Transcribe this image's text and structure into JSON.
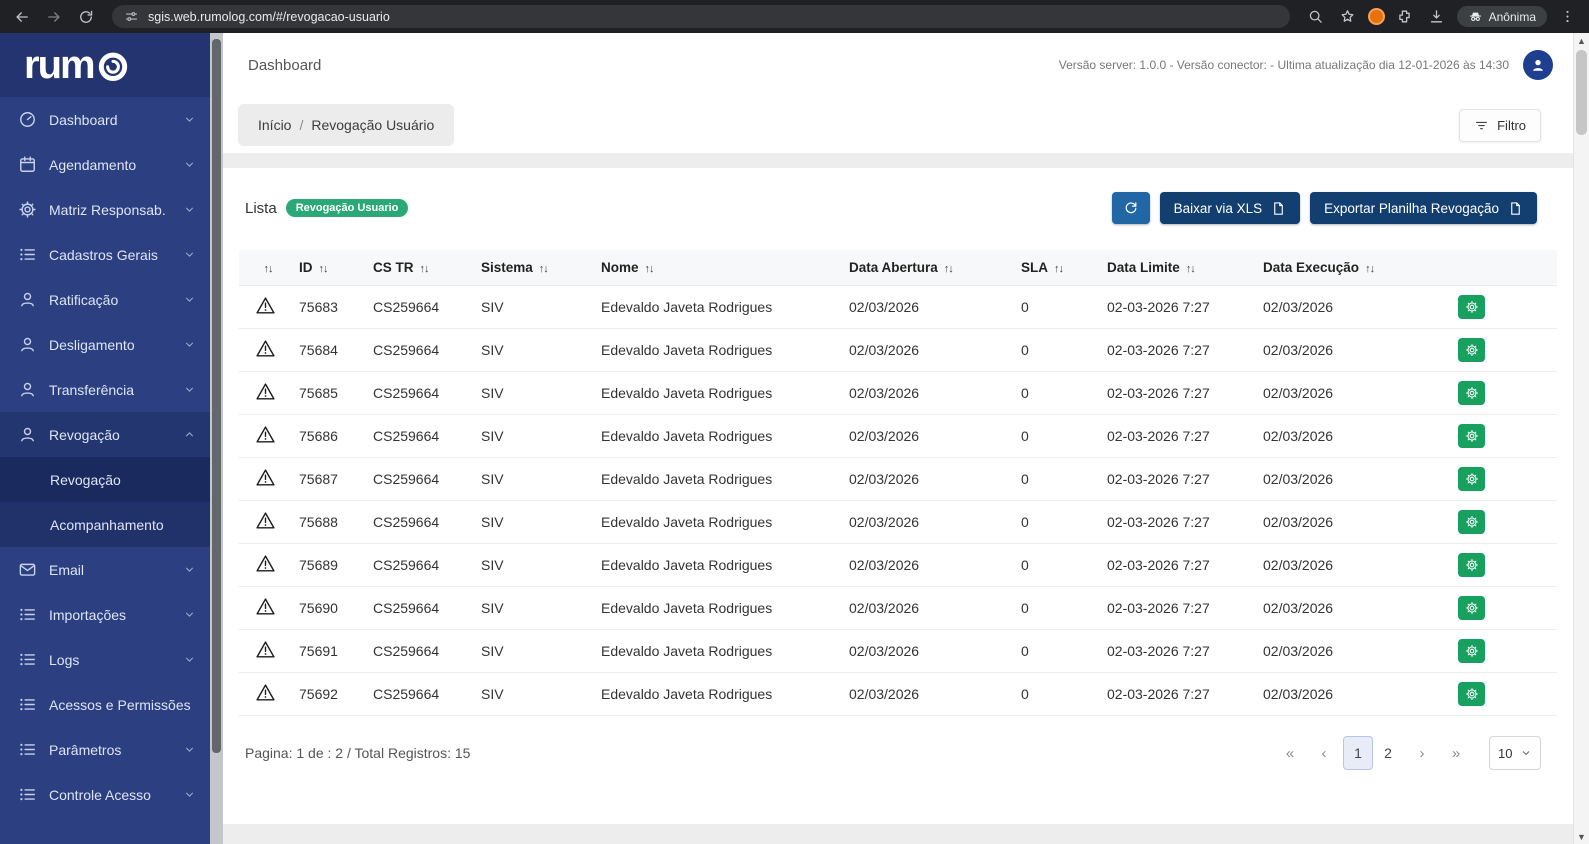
{
  "colors": {
    "sidebar_blue": "#2c3f80",
    "logo_band_blue": "#233470",
    "badge_green": "#2aa876",
    "gear_button_green": "#17a05e",
    "navy_button": "#123e70",
    "refresh_button_blue": "#2166a5",
    "avatar_blue": "#1e3f8f",
    "browser_bar": "#202124",
    "extension_orange": "#e8710a"
  },
  "browser": {
    "url": "sgis.web.rumolog.com/#/revogacao-usuario",
    "profile_label": "Anônima"
  },
  "sidebar": {
    "logo_prefix": "rum",
    "items": [
      {
        "label": "Dashboard",
        "icon": "gauge",
        "chevron": "down"
      },
      {
        "label": "Agendamento",
        "icon": "calendar",
        "chevron": "down"
      },
      {
        "label": "Matriz Responsab.",
        "icon": "gear",
        "chevron": "down"
      },
      {
        "label": "Cadastros Gerais",
        "icon": "list",
        "chevron": "down"
      },
      {
        "label": "Ratificação",
        "icon": "person",
        "chevron": "down"
      },
      {
        "label": "Desligamento",
        "icon": "person",
        "chevron": "down"
      },
      {
        "label": "Transferência",
        "icon": "person",
        "chevron": "down"
      },
      {
        "label": "Revogação",
        "icon": "person",
        "chevron": "up",
        "expanded": true,
        "children": [
          "Revogação",
          "Acompanhamento"
        ],
        "active_child": "Revogação"
      },
      {
        "label": "Email",
        "icon": "mail",
        "chevron": "down"
      },
      {
        "label": "Importações",
        "icon": "list",
        "chevron": "down"
      },
      {
        "label": "Logs",
        "icon": "list",
        "chevron": "down"
      },
      {
        "label": "Acessos e Permissões",
        "icon": "list",
        "chevron": null
      },
      {
        "label": "Parâmetros",
        "icon": "list",
        "chevron": "down"
      },
      {
        "label": "Controle Acesso",
        "icon": "list",
        "chevron": "down"
      }
    ]
  },
  "header": {
    "title": "Dashboard",
    "version_text": "Versão server: 1.0.0 -  Versão conector: -  Ultima atualização dia 12-01-2026 às 14:30"
  },
  "breadcrumb": {
    "home": "Início",
    "separator": "/",
    "current": "Revogação Usuário"
  },
  "toolbar": {
    "filter_label": "Filtro"
  },
  "list": {
    "title": "Lista",
    "badge": "Revogação Usuario",
    "download_xls_label": "Baixar via XLS",
    "export_label": "Exportar Planilha Revogação"
  },
  "table": {
    "columns": [
      "ID",
      "CS TR",
      "Sistema",
      "Nome",
      "Data Abertura",
      "SLA",
      "Data Limite",
      "Data Execução"
    ],
    "rows": [
      {
        "id": "75683",
        "cs_tr": "CS259664",
        "sistema": "SIV",
        "nome": "Edevaldo Javeta Rodrigues",
        "data_abertura": "02/03/2026",
        "sla": "0",
        "data_limite": "02-03-2026 7:27",
        "data_execucao": "02/03/2026"
      },
      {
        "id": "75684",
        "cs_tr": "CS259664",
        "sistema": "SIV",
        "nome": "Edevaldo Javeta Rodrigues",
        "data_abertura": "02/03/2026",
        "sla": "0",
        "data_limite": "02-03-2026 7:27",
        "data_execucao": "02/03/2026"
      },
      {
        "id": "75685",
        "cs_tr": "CS259664",
        "sistema": "SIV",
        "nome": "Edevaldo Javeta Rodrigues",
        "data_abertura": "02/03/2026",
        "sla": "0",
        "data_limite": "02-03-2026 7:27",
        "data_execucao": "02/03/2026"
      },
      {
        "id": "75686",
        "cs_tr": "CS259664",
        "sistema": "SIV",
        "nome": "Edevaldo Javeta Rodrigues",
        "data_abertura": "02/03/2026",
        "sla": "0",
        "data_limite": "02-03-2026 7:27",
        "data_execucao": "02/03/2026"
      },
      {
        "id": "75687",
        "cs_tr": "CS259664",
        "sistema": "SIV",
        "nome": "Edevaldo Javeta Rodrigues",
        "data_abertura": "02/03/2026",
        "sla": "0",
        "data_limite": "02-03-2026 7:27",
        "data_execucao": "02/03/2026"
      },
      {
        "id": "75688",
        "cs_tr": "CS259664",
        "sistema": "SIV",
        "nome": "Edevaldo Javeta Rodrigues",
        "data_abertura": "02/03/2026",
        "sla": "0",
        "data_limite": "02-03-2026 7:27",
        "data_execucao": "02/03/2026"
      },
      {
        "id": "75689",
        "cs_tr": "CS259664",
        "sistema": "SIV",
        "nome": "Edevaldo Javeta Rodrigues",
        "data_abertura": "02/03/2026",
        "sla": "0",
        "data_limite": "02-03-2026 7:27",
        "data_execucao": "02/03/2026"
      },
      {
        "id": "75690",
        "cs_tr": "CS259664",
        "sistema": "SIV",
        "nome": "Edevaldo Javeta Rodrigues",
        "data_abertura": "02/03/2026",
        "sla": "0",
        "data_limite": "02-03-2026 7:27",
        "data_execucao": "02/03/2026"
      },
      {
        "id": "75691",
        "cs_tr": "CS259664",
        "sistema": "SIV",
        "nome": "Edevaldo Javeta Rodrigues",
        "data_abertura": "02/03/2026",
        "sla": "0",
        "data_limite": "02-03-2026 7:27",
        "data_execucao": "02/03/2026"
      },
      {
        "id": "75692",
        "cs_tr": "CS259664",
        "sistema": "SIV",
        "nome": "Edevaldo Javeta Rodrigues",
        "data_abertura": "02/03/2026",
        "sla": "0",
        "data_limite": "02-03-2026 7:27",
        "data_execucao": "02/03/2026"
      }
    ]
  },
  "pagination": {
    "summary": "Pagina: 1 de : 2 / Total Registros: 15",
    "pages": [
      "1",
      "2"
    ],
    "active_page": "1",
    "page_size": "10",
    "first": "«",
    "prev": "‹",
    "next": "›",
    "last": "»"
  }
}
